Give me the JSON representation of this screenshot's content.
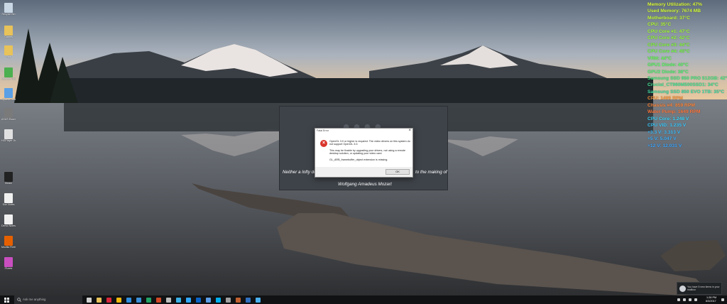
{
  "desktop": {
    "icons": [
      {
        "label": "Recycle Bin",
        "icon": "recycle-bin-icon",
        "color": "#c9d6e3"
      },
      {
        "label": "Games",
        "icon": "folder-icon",
        "color": "#e8c25a"
      },
      {
        "label": "Pics",
        "icon": "folder-icon",
        "color": "#e8c25a"
      },
      {
        "label": "Security Tools",
        "icon": "shield-icon",
        "color": "#4caf50"
      },
      {
        "label": "System Tools",
        "icon": "gear-icon",
        "color": "#5aa0e6"
      },
      {
        "label": "ASUS Essence 1.6.1",
        "icon": "audio-app-icon",
        "color": "#7a7a7a"
      },
      {
        "label": "HGPlayer Desktop 1",
        "icon": "app-window-icon",
        "color": "#e0e0e0"
      },
      {
        "label": "Steam",
        "icon": "steam-icon",
        "color": "#222222"
      },
      {
        "label": "Doc Notes",
        "icon": "document-icon",
        "color": "#f0f0f0"
      },
      {
        "label": "Demo Notes",
        "icon": "document-icon",
        "color": "#f0f0f0"
      },
      {
        "label": "Mozilla Firefox",
        "icon": "firefox-icon",
        "color": "#e66000"
      },
      {
        "label": "iTunes",
        "icon": "music-note-icon",
        "color": "#c94fc0"
      }
    ]
  },
  "sensors": [
    {
      "text": "Memory Utilization: 47%",
      "color": "#e0ff40"
    },
    {
      "text": "Used Memory: 7674 MB",
      "color": "#d6ff40"
    },
    {
      "text": "Motherboard: 37°C",
      "color": "#c8ff40"
    },
    {
      "text": "CPU: 35°C",
      "color": "#b8ff40"
    },
    {
      "text": "CPU Core #1: 47°C",
      "color": "#a8ff40"
    },
    {
      "text": "CPU Core #2: 42°C",
      "color": "#99ff40"
    },
    {
      "text": "CPU Core #3: 44°C",
      "color": "#88ff40"
    },
    {
      "text": "CPU Core #4: 45°C",
      "color": "#78ff48"
    },
    {
      "text": "VRM: 44°C",
      "color": "#68ff58"
    },
    {
      "text": "GPU1 Diode: 40°C",
      "color": "#5cff68"
    },
    {
      "text": "GPU2 Diode: 38°C",
      "color": "#54f878"
    },
    {
      "text": "Samsung SSD 950 PRO 512GB: 42°C",
      "color": "#4cf088"
    },
    {
      "text": "Crucial_CT960M500SSD1: 34°C",
      "color": "#48e898"
    },
    {
      "text": "Samsung SSD 850 EVO 1TB: 35°C",
      "color": "#44e0a8"
    },
    {
      "text": "CPU: 1495 RPM",
      "color": "#ff9a40"
    },
    {
      "text": "Chassis #4: 859 RPM",
      "color": "#ff8a40"
    },
    {
      "text": "Water Pump: 1649 RPM",
      "color": "#ff7a40"
    },
    {
      "text": "CPU Core: 1.248 V",
      "color": "#40d8ff"
    },
    {
      "text": "CPU VID: 1.235 V",
      "color": "#40ccff"
    },
    {
      "text": "+3.3 V: 3.313 V",
      "color": "#40c0ff"
    },
    {
      "text": "+5 V: 5.047 V",
      "color": "#40b4ff"
    },
    {
      "text": "+12 V: 12.031 V",
      "color": "#40a8ff"
    }
  ],
  "splash": {
    "quote_line1_left": "Neither a lofty deg",
    "quote_line1_right": "to the making of",
    "quote_author": "Wolfgang Amadeus Mozart"
  },
  "dialog": {
    "title": "Fatal Error",
    "close_label": "×",
    "line1": "OpenGL 3.0 or higher is required. The video drivers on this system do not support OpenGL 3.0.",
    "line2": "This may be fixable by upgrading your drivers, not using a remote desktop solution, or updating your video card.",
    "line3": "GL_ARB_framebuffer_object extension is missing.",
    "ok_label": "OK"
  },
  "taskbar": {
    "search_placeholder": "Ask me anything",
    "apps": [
      {
        "icon": "task-view-icon",
        "color": "#d0d0d0"
      },
      {
        "icon": "explorer-icon",
        "color": "#e8c25a"
      },
      {
        "icon": "opera-icon",
        "color": "#d8263a"
      },
      {
        "icon": "chrome-icon",
        "color": "#f2b90c"
      },
      {
        "icon": "edge-icon",
        "color": "#2f8ee0"
      },
      {
        "icon": "store-icon",
        "color": "#3a8fd8"
      },
      {
        "icon": "excel-icon",
        "color": "#21a366"
      },
      {
        "icon": "powerpoint-icon",
        "color": "#d24726"
      },
      {
        "icon": "settings-icon",
        "color": "#bdbdbd"
      },
      {
        "icon": "media-icon",
        "color": "#3ab0e8"
      },
      {
        "icon": "photoshop-icon",
        "color": "#31a8ff"
      },
      {
        "icon": "outlook-icon",
        "color": "#0a64c8"
      },
      {
        "icon": "mail-icon",
        "color": "#5c9ee8"
      },
      {
        "icon": "skype-icon",
        "color": "#00aff0"
      },
      {
        "icon": "app-icon",
        "color": "#a0a0a0"
      },
      {
        "icon": "app-icon",
        "color": "#c06030"
      },
      {
        "icon": "app-icon",
        "color": "#3070c0"
      },
      {
        "icon": "twitter-icon",
        "color": "#4ab0f0"
      }
    ],
    "clock_time": "1:28 PM",
    "clock_date": "6/3/2017"
  },
  "toast": {
    "text": "You have 5 new items in your mailbox"
  }
}
